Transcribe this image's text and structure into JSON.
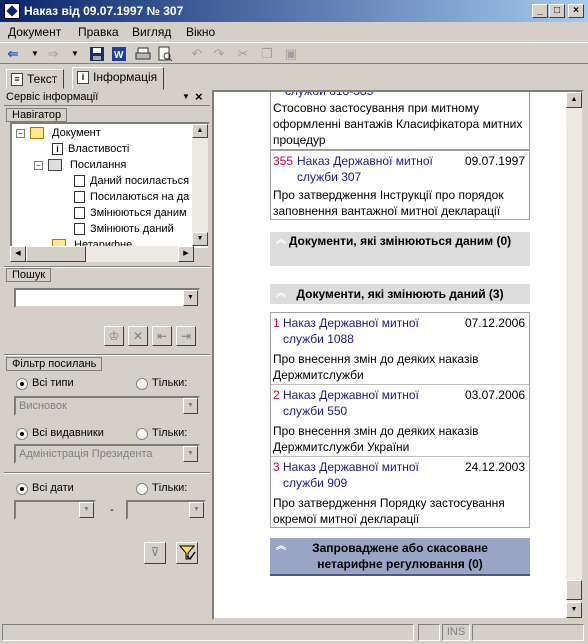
{
  "window": {
    "title": "Наказ від 09.07.1997 № 307"
  },
  "menu": [
    "Документ",
    "Правка",
    "Вигляд",
    "Вікно"
  ],
  "tabs": [
    {
      "label": "Текст"
    },
    {
      "label": "Інформація"
    }
  ],
  "left_panel": {
    "title": "Сервіс інформації",
    "navigator": {
      "label": "Навігатор",
      "tree": [
        {
          "label": "Документ"
        },
        {
          "label": "Властивості"
        },
        {
          "label": "Посилання"
        },
        {
          "label": "Даний посилається"
        },
        {
          "label": "Посилаються на да"
        },
        {
          "label": "Змінюються даним"
        },
        {
          "label": "Змінюють даний"
        },
        {
          "label": "Нетарифне"
        }
      ]
    },
    "search": {
      "label": "Пошук",
      "value": ""
    },
    "filter": {
      "label": "Фільтр посилань",
      "all_types": "Всі типи",
      "only": "Тільки:",
      "type_value": "Висновок",
      "all_publishers": "Всі видавники",
      "publisher_value": "Адміністрація Президента",
      "all_dates": "Всі дати",
      "date_sep": "-"
    }
  },
  "doc": {
    "top_partial": "служби 818-585",
    "top_desc": "Стосовно застосування при митному оформленні вантажів Класифікатора митних процедур",
    "entry355": {
      "num": "355",
      "title": "Наказ Державної митної служби 307",
      "date": "09.07.1997",
      "desc": "Про затвердження Інструкції про порядок заповнення вантажної митної декларації"
    },
    "section1": "Документи, які змінюються даним (0)",
    "section2": "Документи, які змінюють даний (3)",
    "entries": [
      {
        "num": "1",
        "title": "Наказ Державної митної служби 1088",
        "date": "07.12.2006",
        "desc": "Про внесення змін до деяких наказів Держмитслужби"
      },
      {
        "num": "2",
        "title": "Наказ Державної митної служби 550",
        "date": "03.07.2006",
        "desc": "Про внесення змін до деяких наказів Держмитслужби України"
      },
      {
        "num": "3",
        "title": "Наказ Державної митної служби 909",
        "date": "24.12.2003",
        "desc": "Про затвердження Порядку застосування окремої митної декларації"
      }
    ],
    "section3": "Запроваджене або скасоване нетарифне регулювання (0)"
  },
  "status": {
    "ins": "INS"
  }
}
